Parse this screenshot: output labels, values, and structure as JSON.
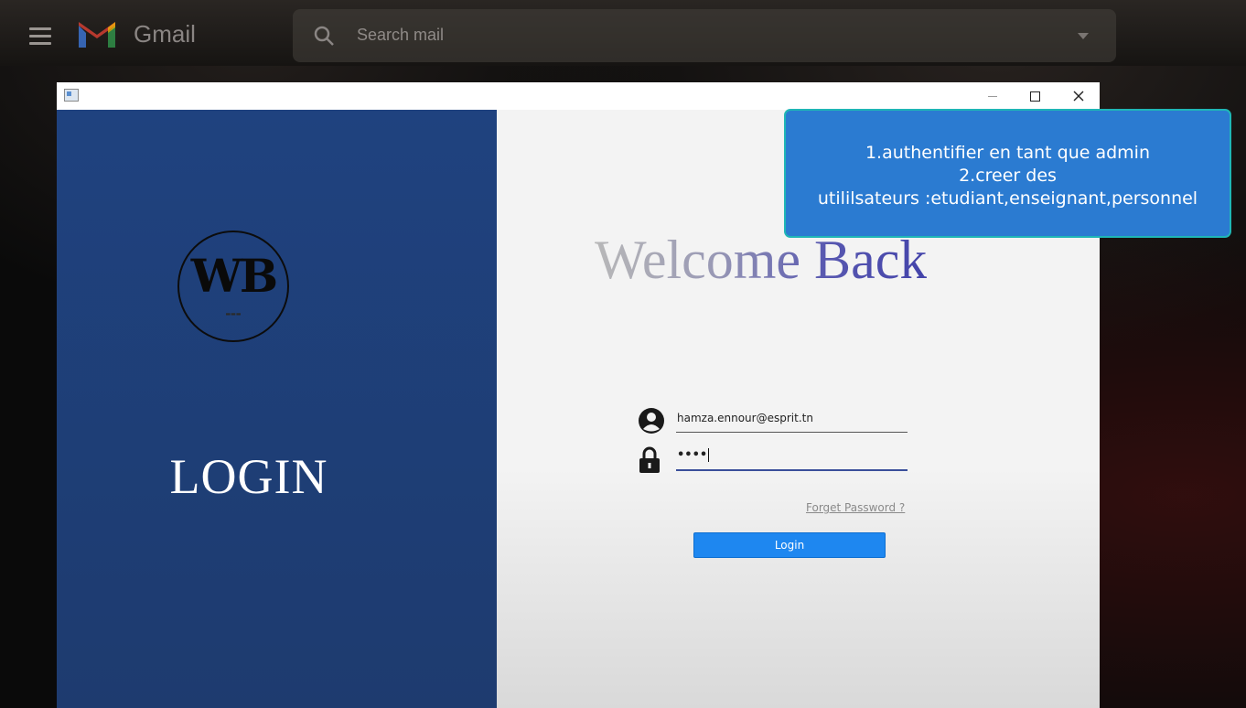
{
  "gmail": {
    "app_name": "Gmail",
    "search_placeholder": "Search mail"
  },
  "window": {
    "left_panel": {
      "logo_text": "WB",
      "title": "LOGIN"
    },
    "right_panel": {
      "welcome": "Welcome Back",
      "email_value": "hamza.ennour@esprit.tn",
      "password_masked": "••••",
      "forget_password": "Forget Password ?",
      "login_button": "Login"
    }
  },
  "note": {
    "lines": [
      "1.authentifier en tant que admin",
      "2.creer des",
      "utililsateurs :etudiant,enseignant,personnel"
    ]
  },
  "colors": {
    "left_panel": "#1f427f",
    "login_button": "#1e87f0",
    "note_bg": "#2b7bd1",
    "note_border": "#1fb6b6"
  }
}
